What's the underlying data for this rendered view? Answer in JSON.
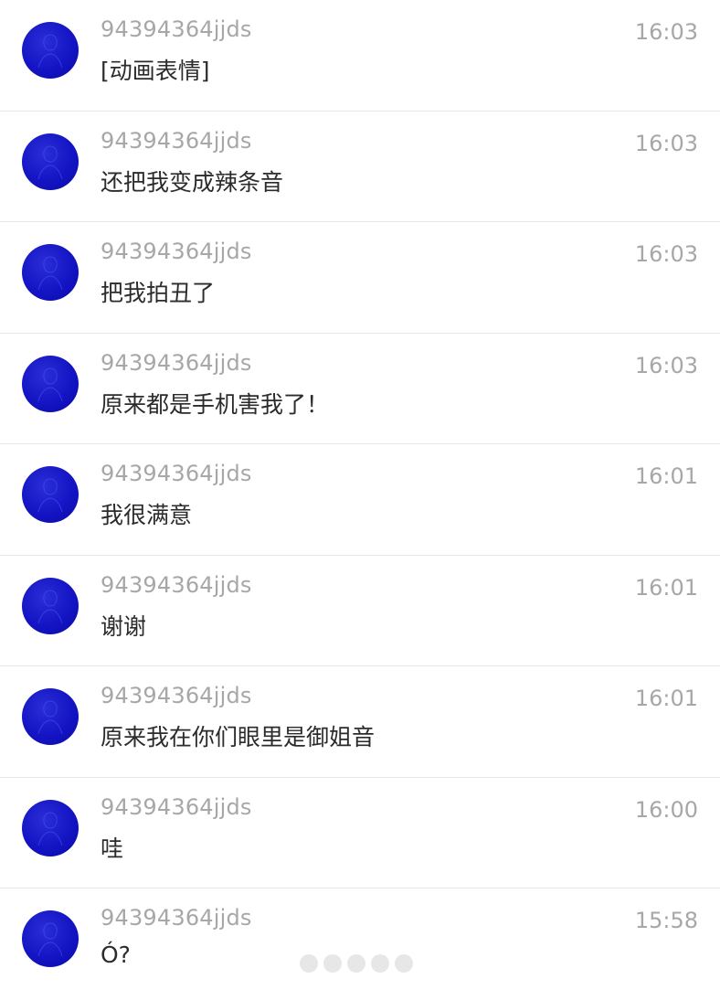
{
  "messages": [
    {
      "sender": "94394364jjds",
      "time": "16:03",
      "text": "[动画表情]"
    },
    {
      "sender": "94394364jjds",
      "time": "16:03",
      "text": "还把我变成辣条音"
    },
    {
      "sender": "94394364jjds",
      "time": "16:03",
      "text": "把我拍丑了"
    },
    {
      "sender": "94394364jjds",
      "time": "16:03",
      "text": "原来都是手机害我了！"
    },
    {
      "sender": "94394364jjds",
      "time": "16:01",
      "text": "我很满意"
    },
    {
      "sender": "94394364jjds",
      "time": "16:01",
      "text": "谢谢"
    },
    {
      "sender": "94394364jjds",
      "time": "16:01",
      "text": "原来我在你们眼里是御姐音"
    },
    {
      "sender": "94394364jjds",
      "time": "16:00",
      "text": "哇"
    },
    {
      "sender": "94394364jjds",
      "time": "15:58",
      "text": "Ó?"
    }
  ],
  "colors": {
    "avatar": "#1414c4",
    "sender_text": "#a7a7a7",
    "message_text": "#2b2b2b",
    "divider": "#e6e6e6"
  },
  "icons": {
    "avatar": "blue-round-avatar-icon"
  }
}
